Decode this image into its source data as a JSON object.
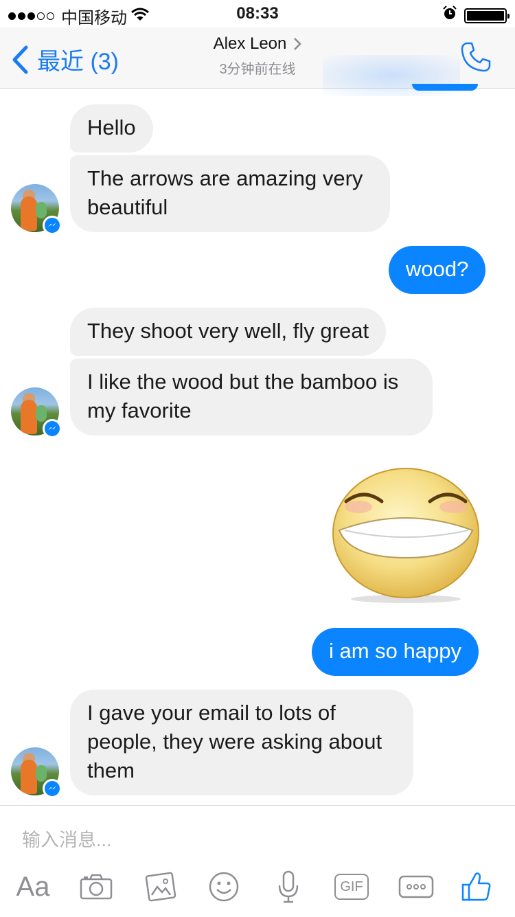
{
  "status_bar": {
    "carrier": "中国移动",
    "time": "08:33"
  },
  "nav": {
    "back_label": "最近 (3)",
    "title": "Alex Leon",
    "subtitle": "3分钟前在线"
  },
  "messages": [
    {
      "from": "them",
      "text": "Hello"
    },
    {
      "from": "them",
      "text": "The arrows are amazing very beautiful"
    },
    {
      "from": "me",
      "text": "wood?"
    },
    {
      "from": "them",
      "text": "They shoot very well, fly great"
    },
    {
      "from": "them",
      "text": "I like the wood but the bamboo is my favorite"
    },
    {
      "from": "me",
      "type": "sticker",
      "icon": "laughing-emoji-sticker"
    },
    {
      "from": "me",
      "text": "i  am so happy"
    },
    {
      "from": "them",
      "text": "I gave your email to lots of people, they were asking about them"
    }
  ],
  "composer": {
    "placeholder": "输入消息...",
    "tools": [
      {
        "icon": "text-format-icon",
        "label": "Aa"
      },
      {
        "icon": "camera-icon"
      },
      {
        "icon": "photo-icon"
      },
      {
        "icon": "emoji-icon"
      },
      {
        "icon": "microphone-icon"
      },
      {
        "icon": "gif-icon",
        "label": "GIF"
      },
      {
        "icon": "more-icon"
      },
      {
        "icon": "thumbs-up-icon"
      }
    ]
  },
  "colors": {
    "accent": "#0a84ff",
    "incoming_bubble": "#f0f0f0",
    "secondary_text": "#8e8e93"
  }
}
